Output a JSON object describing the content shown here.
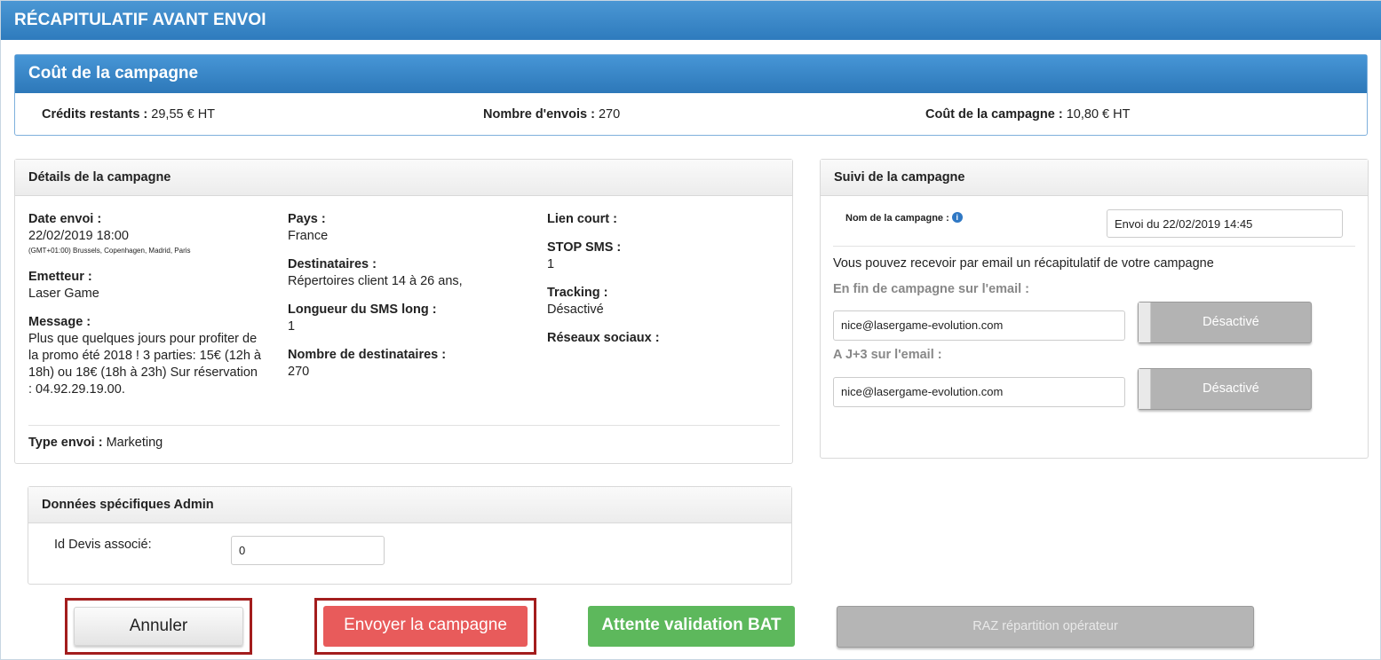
{
  "header": {
    "title": "RÉCAPITULATIF AVANT ENVOI"
  },
  "cost": {
    "title": "Coût de la campagne",
    "credits_label": "Crédits restants :",
    "credits_value": "29,55 € HT",
    "sends_label": "Nombre d'envois :",
    "sends_value": "270",
    "cost_label": "Coût de la campagne :",
    "cost_value": "10,80 € HT"
  },
  "details": {
    "title": "Détails de la campagne",
    "date_label": "Date envoi :",
    "date_value": "22/02/2019 18:00",
    "timezone": "(GMT+01:00) Brussels, Copenhagen, Madrid, Paris",
    "sender_label": "Emetteur :",
    "sender_value": "Laser Game",
    "message_label": "Message :",
    "message_value": "Plus que quelques jours pour profiter de la promo été 2018 ! 3 parties: 15€ (12h à 18h) ou 18€ (18h à 23h) Sur réservation : 04.92.29.19.00.",
    "country_label": "Pays :",
    "country_value": "France",
    "recipients_label": "Destinataires :",
    "recipients_value": "Répertoires client 14 à 26 ans,",
    "sms_length_label": "Longueur du SMS long :",
    "sms_length_value": "1",
    "recipient_count_label": "Nombre de destinataires :",
    "recipient_count_value": "270",
    "short_link_label": "Lien court :",
    "stop_sms_label": "STOP SMS :",
    "stop_sms_value": "1",
    "tracking_label": "Tracking :",
    "tracking_value": "Désactivé",
    "social_label": "Réseaux sociaux :",
    "type_label": "Type envoi :",
    "type_value": "Marketing"
  },
  "suivi": {
    "title": "Suivi de la campagne",
    "name_label": "Nom de la campagne :",
    "name_value": "Envoi du 22/02/2019 14:45",
    "info_text": "Vous pouvez recevoir par email un récapitulatif de votre campagne",
    "end_label": "En fin de campagne sur l'email :",
    "end_email": "nice@lasergame-evolution.com",
    "end_toggle": "Désactivé",
    "j3_label": "A J+3 sur l'email :",
    "j3_email": "nice@lasergame-evolution.com",
    "j3_toggle": "Désactivé"
  },
  "admin": {
    "title": "Données spécifiques Admin",
    "devis_label": "Id Devis associé:",
    "devis_value": "0"
  },
  "actions": {
    "cancel": "Annuler",
    "send": "Envoyer la campagne",
    "bat": "Attente validation BAT",
    "raz": "RAZ répartition opérateur"
  }
}
